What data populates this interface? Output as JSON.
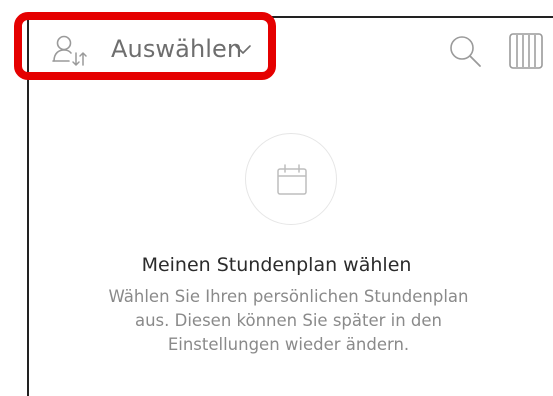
{
  "toolbar": {
    "selector_label": "Auswählen",
    "icons": {
      "user_switch": "user-switch-icon",
      "chevron": "chevron-down-icon",
      "search": "search-icon",
      "view": "column-view-icon"
    },
    "highlight_color": "#e50000"
  },
  "empty_state": {
    "icon": "calendar-icon",
    "title": "Meinen Stundenplan wählen",
    "lines": [
      "Wählen Sie Ihren persönlichen Stundenplan",
      "aus. Diesen können Sie später in den",
      "Einstellungen wieder ändern."
    ]
  }
}
